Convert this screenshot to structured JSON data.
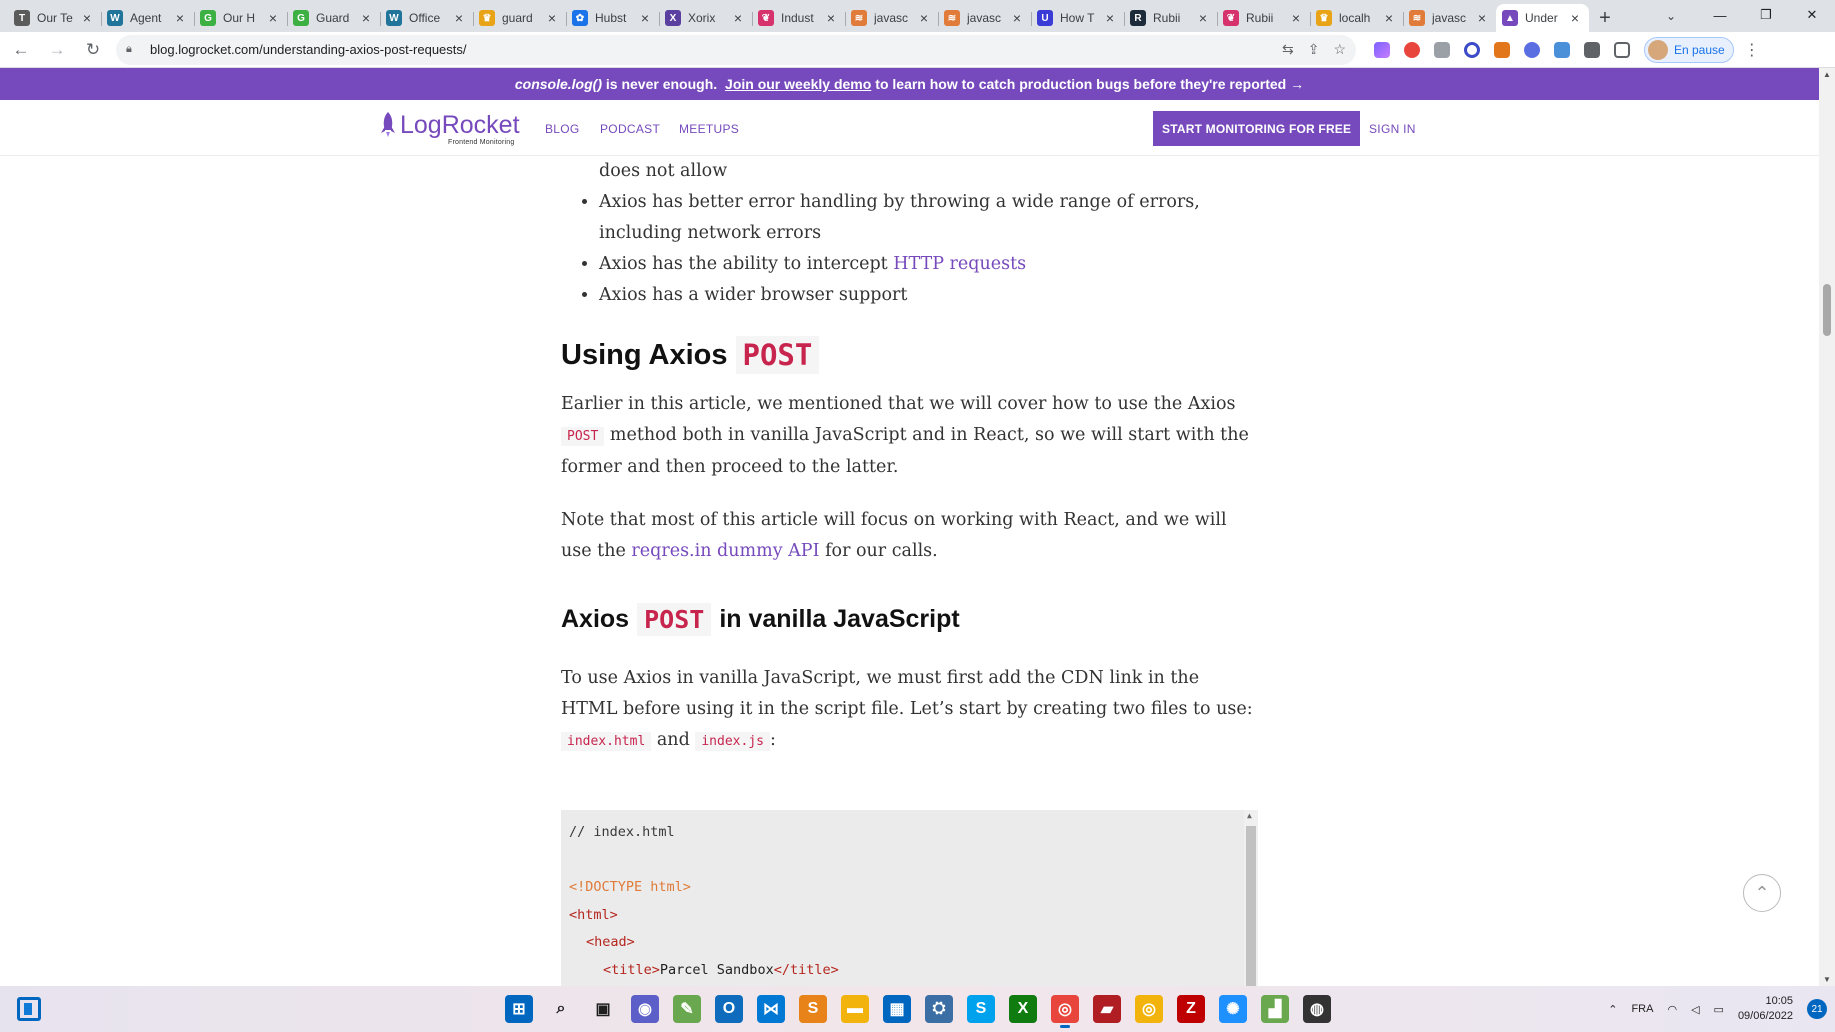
{
  "browser": {
    "tabs": [
      {
        "label": "Our Te",
        "color": "#5b5b5b",
        "glyph": "T"
      },
      {
        "label": "Agent",
        "color": "#21759b",
        "glyph": "W"
      },
      {
        "label": "Our H",
        "color": "#3cb043",
        "glyph": "G"
      },
      {
        "label": "Guard",
        "color": "#3cb043",
        "glyph": "G"
      },
      {
        "label": "Office",
        "color": "#21759b",
        "glyph": "W"
      },
      {
        "label": "guard",
        "color": "#e8a317",
        "glyph": "♛"
      },
      {
        "label": "Hubst",
        "color": "#1a73e8",
        "glyph": "✿"
      },
      {
        "label": "Xorix",
        "color": "#5b3fa0",
        "glyph": "X"
      },
      {
        "label": "Indust",
        "color": "#d6336c",
        "glyph": "❦"
      },
      {
        "label": "javasc",
        "color": "#e07b39",
        "glyph": "≋"
      },
      {
        "label": "javasc",
        "color": "#e07b39",
        "glyph": "≋"
      },
      {
        "label": "How T",
        "color": "#3b3bd6",
        "glyph": "U"
      },
      {
        "label": "Rubii",
        "color": "#1d2b3a",
        "glyph": "R"
      },
      {
        "label": "Rubii",
        "color": "#d6336c",
        "glyph": "❦"
      },
      {
        "label": "localh",
        "color": "#e8a317",
        "glyph": "♛"
      },
      {
        "label": "javasc",
        "color": "#e07b39",
        "glyph": "≋"
      },
      {
        "label": "Under",
        "color": "#764abc",
        "glyph": "▲",
        "active": true
      }
    ],
    "url": "blog.logrocket.com/understanding-axios-post-requests/",
    "profile_label": "En pause"
  },
  "banner": {
    "part1": "console.log()",
    "part2": "is never enough.",
    "link": "Join our weekly demo",
    "part3": "to learn how to catch production bugs before they're reported →"
  },
  "site_nav": {
    "logo_text": "LogRocket",
    "logo_sub": "Frontend Monitoring",
    "links": [
      "BLOG",
      "PODCAST",
      "MEETUPS"
    ],
    "cta": "START MONITORING FOR FREE",
    "signin": "SIGN IN"
  },
  "article": {
    "list_items": [
      {
        "text": "does not allow",
        "continuation": true
      },
      {
        "text": "Axios has better error handling by throwing a wide range of errors, including network errors"
      },
      {
        "text": "Axios has the ability to intercept ",
        "link": "HTTP requests"
      },
      {
        "text": "Axios has a wider browser support"
      }
    ],
    "h2": {
      "text": "Using Axios",
      "code": "POST"
    },
    "p1": {
      "a": "Earlier in this article, we mentioned that we will cover how to use the Axios",
      "code": "POST",
      "b": "method both in vanilla JavaScript and in React, so we will start with the former and then proceed to the latter."
    },
    "p2": {
      "a": "Note that most of this article will focus on working with React, and we will use the",
      "link": "reqres.in dummy API",
      "b": "for our calls."
    },
    "h3": {
      "a": "Axios",
      "code": "POST",
      "b": "in vanilla JavaScript"
    },
    "p3": {
      "a": "To use Axios in vanilla JavaScript, we must first add the CDN link in the HTML before using it in the script file. Let’s start by creating two files to use:",
      "code1": "index.html",
      "mid": "and",
      "code2": "index.js",
      "end": ":"
    },
    "code_lines": [
      {
        "text": "// index.html",
        "kind": "comment",
        "indent": 0
      },
      {
        "text": "",
        "kind": "text",
        "indent": 0
      },
      {
        "text": "<!DOCTYPE html>",
        "kind": "doctype",
        "indent": 0
      },
      {
        "text": "<html>",
        "kind": "tag",
        "indent": 0
      },
      {
        "text": "<head>",
        "kind": "tag",
        "indent": 1
      },
      {
        "tag_open": "<title>",
        "text": "Parcel Sandbox",
        "tag_close": "</title>",
        "kind": "mixed",
        "indent": 2
      }
    ]
  },
  "taskbar": {
    "apps": [
      {
        "name": "start",
        "color": "#0067c0",
        "glyph": "⊞"
      },
      {
        "name": "search",
        "color": "#202020",
        "glyph": "⌕"
      },
      {
        "name": "task-view",
        "color": "#202020",
        "glyph": "▣"
      },
      {
        "name": "chat",
        "color": "#5b5fc7",
        "glyph": "◉"
      },
      {
        "name": "app-green",
        "color": "#6aa84f",
        "glyph": "✎"
      },
      {
        "name": "outlook",
        "color": "#0f6cbd",
        "glyph": "O"
      },
      {
        "name": "vscode",
        "color": "#0078d4",
        "glyph": "⋈"
      },
      {
        "name": "sublime",
        "color": "#e8831a",
        "glyph": "S"
      },
      {
        "name": "explorer",
        "color": "#f2b40c",
        "glyph": "▬"
      },
      {
        "name": "store",
        "color": "#0067c0",
        "glyph": "▦"
      },
      {
        "name": "network",
        "color": "#3a6ea5",
        "glyph": "⛭"
      },
      {
        "name": "skype",
        "color": "#00a2ed",
        "glyph": "S"
      },
      {
        "name": "xbox",
        "color": "#107c10",
        "glyph": "X"
      },
      {
        "name": "chrome",
        "color": "#e8453c",
        "glyph": "◎",
        "active": true
      },
      {
        "name": "app-red",
        "color": "#b01e23",
        "glyph": "▰"
      },
      {
        "name": "chrome-canary",
        "color": "#f2b40c",
        "glyph": "◎"
      },
      {
        "name": "filezilla",
        "color": "#bf0000",
        "glyph": "Z"
      },
      {
        "name": "settings-blue",
        "color": "#1e90ff",
        "glyph": "✺"
      },
      {
        "name": "chart-app",
        "color": "#6aa84f",
        "glyph": "▟"
      },
      {
        "name": "github",
        "color": "#333333",
        "glyph": "◍"
      }
    ],
    "lang": "FRA",
    "time": "10:05",
    "date": "09/06/2022",
    "notif_count": "21"
  }
}
